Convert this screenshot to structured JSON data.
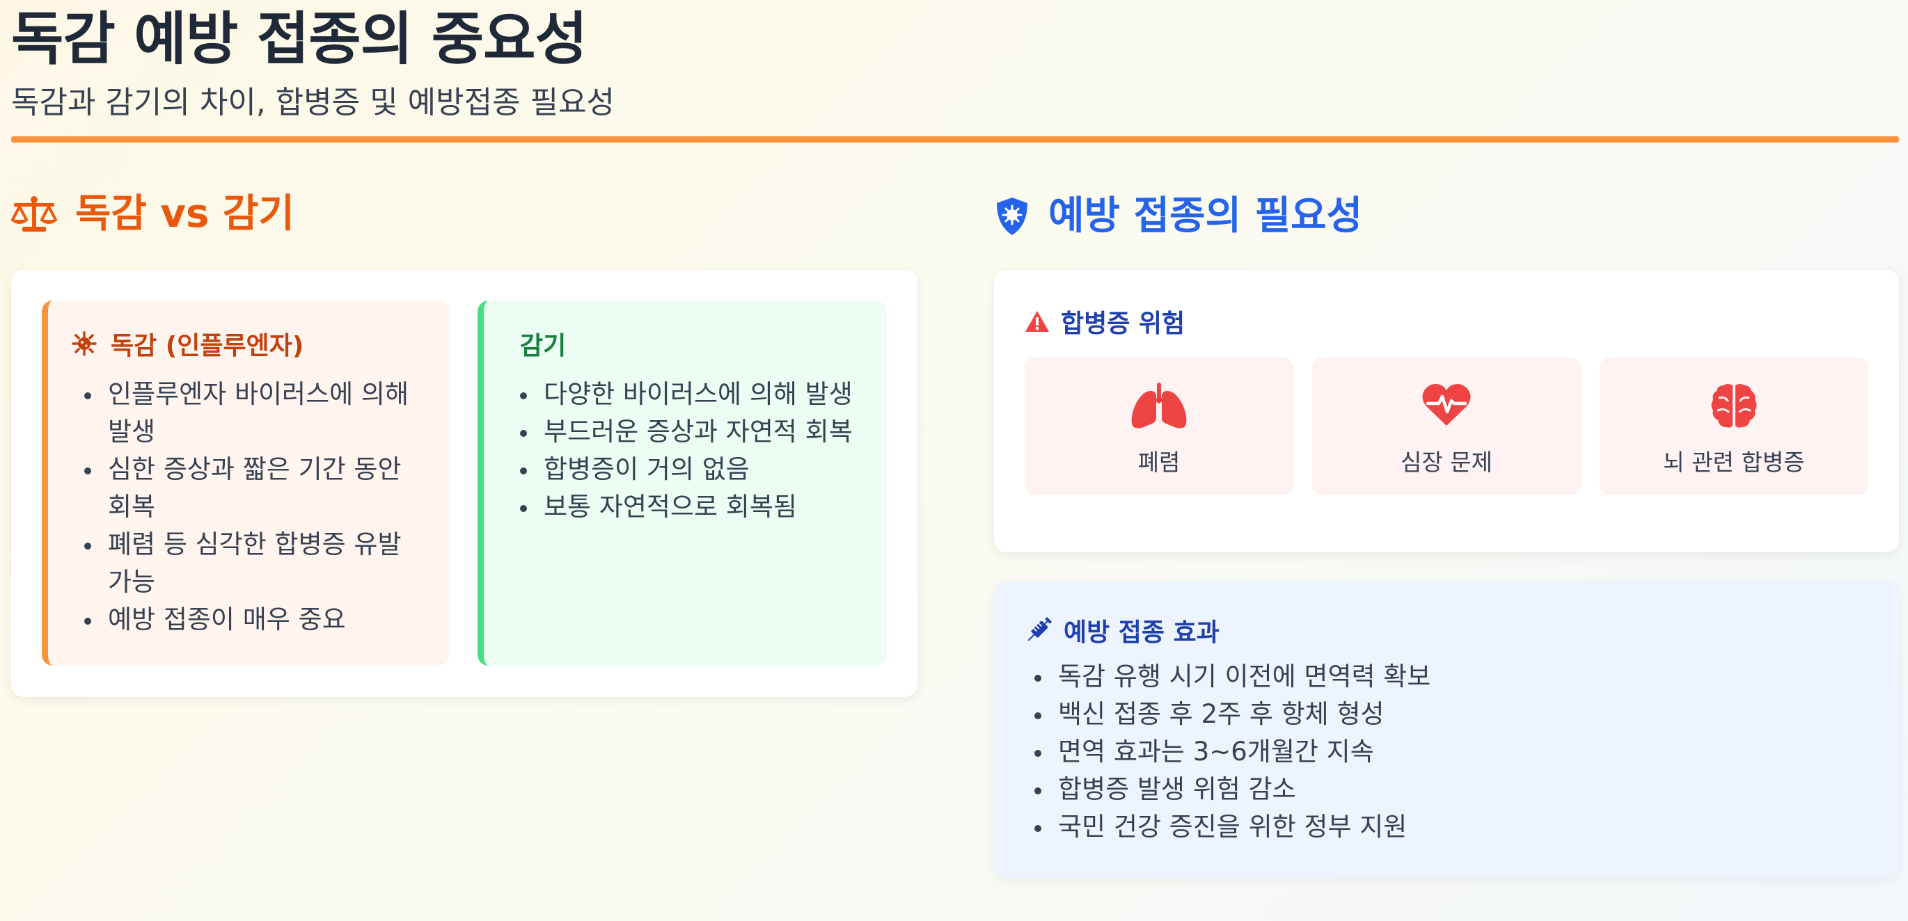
{
  "header": {
    "title": "독감 예방 접종의 중요성",
    "subtitle": "독감과 감기의 차이, 합병증 및 예방접종 필요성"
  },
  "comparison": {
    "heading": "독감 vs 감기",
    "flu": {
      "title": "독감 (인플루엔자)",
      "items": [
        "인플루엔자 바이러스에 의해 발생",
        "심한 증상과 짧은 기간 동안 회복",
        "폐렴 등 심각한 합병증 유발 가능",
        "예방 접종이 매우 중요"
      ]
    },
    "cold": {
      "title": "감기",
      "items": [
        "다양한 바이러스에 의해 발생",
        "부드러운 증상과 자연적 회복",
        "합병증이 거의 없음",
        "보통 자연적으로 회복됨"
      ]
    }
  },
  "necessity": {
    "heading": "예방 접종의 필요성",
    "risk": {
      "title": "합병증 위험",
      "tiles": [
        {
          "label": "폐렴",
          "icon": "lungs-icon"
        },
        {
          "label": "심장 문제",
          "icon": "heart-pulse-icon"
        },
        {
          "label": "뇌 관련 합병증",
          "icon": "brain-icon"
        }
      ]
    },
    "effect": {
      "title": "예방 접종 효과",
      "items": [
        "독감 유행 시기 이전에 면역력 확보",
        "백신 접종 후 2주 후 항체 형성",
        "면역 효과는 3~6개월간 지속",
        "합병증 발생 위험 감소",
        "국민 건강 증진을 위한 정부 지원"
      ]
    }
  },
  "colors": {
    "accent_orange": "#fb923c",
    "heading_orange": "#ea580c",
    "heading_blue": "#2563eb",
    "cold_green": "#4ade80",
    "risk_red": "#ef4444"
  }
}
